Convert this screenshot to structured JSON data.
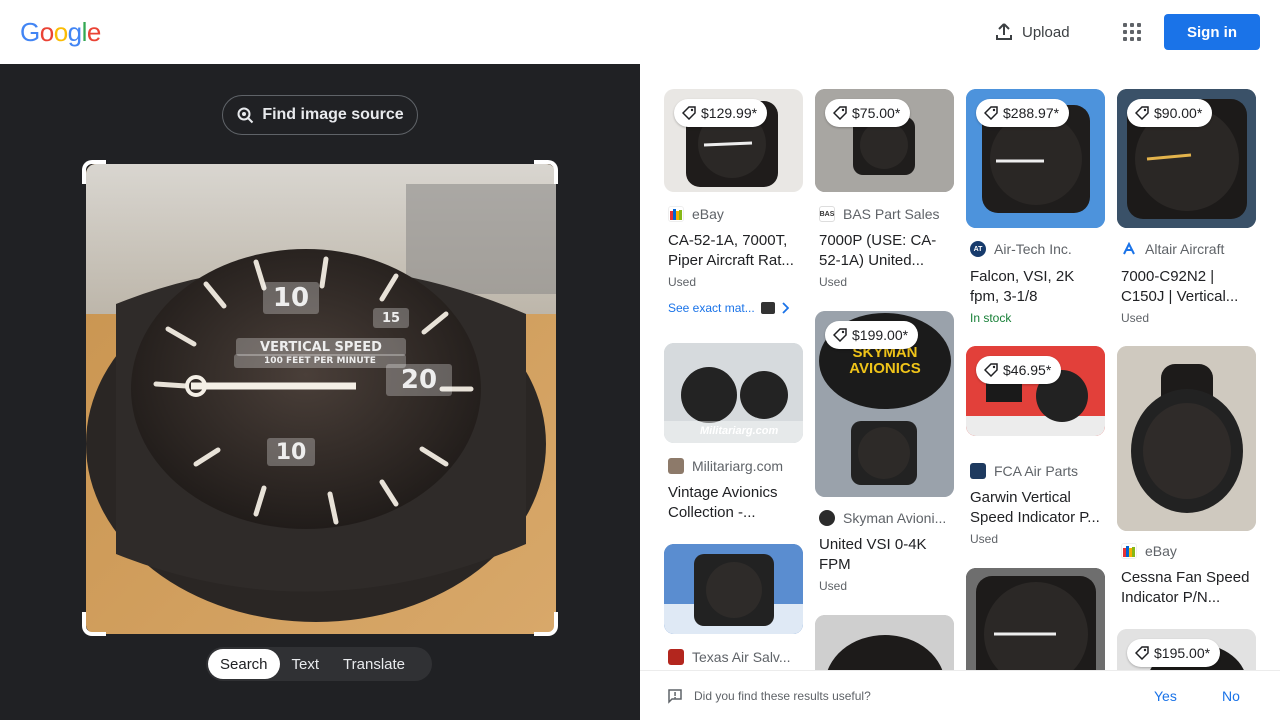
{
  "header": {
    "logo_letters": [
      {
        "ch": "G",
        "color": "#4285F4"
      },
      {
        "ch": "o",
        "color": "#EA4335"
      },
      {
        "ch": "o",
        "color": "#FBBC05"
      },
      {
        "ch": "g",
        "color": "#4285F4"
      },
      {
        "ch": "l",
        "color": "#34A853"
      },
      {
        "ch": "e",
        "color": "#EA4335"
      }
    ],
    "upload_label": "Upload",
    "signin_label": "Sign in"
  },
  "left": {
    "find_source_label": "Find image source",
    "overlay_texts": [
      "10",
      "15",
      "VERTICAL SPEED",
      "100 FEET PER MINUTE",
      "20",
      "10"
    ],
    "modes": [
      {
        "label": "Search",
        "active": true
      },
      {
        "label": "Text",
        "active": false
      },
      {
        "label": "Translate",
        "active": false
      }
    ]
  },
  "results": {
    "c1": [
      {
        "price": "$129.99*",
        "source": "eBay",
        "title": "CA-52-1A, 7000T, Piper Aircraft Rat...",
        "meta": "Used",
        "exact": "See exact mat..."
      },
      {
        "source": "Militariarg.com",
        "title": "Vintage Avionics Collection -...",
        "thumb_caption": "Militariarg.com"
      },
      {
        "source": "Texas Air Salv..."
      }
    ],
    "c2": [
      {
        "price": "$75.00*",
        "source": "BAS Part Sales",
        "title": "7000P (USE: CA-52-1A) United...",
        "meta": "Used"
      },
      {
        "price": "$199.00*",
        "source": "Skyman Avioni...",
        "title": "United VSI 0-4K FPM",
        "meta": "Used",
        "thumb_caption": "SKYMAN AVIONICS"
      }
    ],
    "c3": [
      {
        "price": "$288.97*",
        "source": "Air-Tech Inc.",
        "title": "Falcon, VSI, 2K fpm, 3-1/8",
        "meta": "In stock"
      },
      {
        "price": "$46.95*",
        "source": "FCA Air Parts",
        "title": "Garwin Vertical Speed Indicator P...",
        "meta": "Used"
      }
    ],
    "c4": [
      {
        "price": "$90.00*",
        "source": "Altair Aircraft",
        "title": "7000-C92N2 | C150J | Vertical...",
        "meta": "Used"
      },
      {
        "source": "eBay",
        "title": "Cessna Fan Speed Indicator P/N..."
      },
      {
        "price": "$195.00*"
      }
    ]
  },
  "feedback": {
    "question": "Did you find these results useful?",
    "yes": "Yes",
    "no": "No"
  }
}
